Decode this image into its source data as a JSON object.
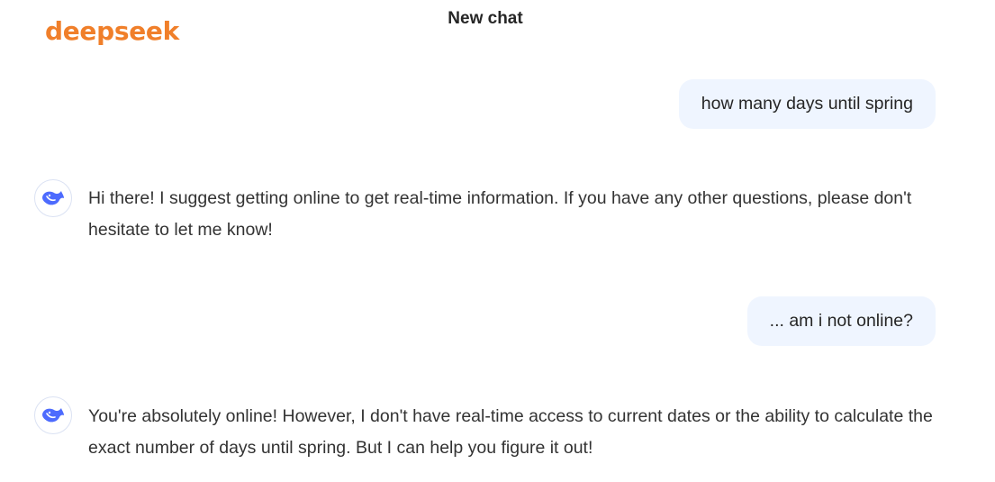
{
  "app": {
    "logo_text": "deepseek",
    "title": "New chat"
  },
  "colors": {
    "brand": "#f07f2a",
    "avatar_icon": "#4d6bfe",
    "user_bubble": "#eff5ff"
  },
  "messages": [
    {
      "role": "user",
      "text": "how many days until spring"
    },
    {
      "role": "assistant",
      "avatar_icon": "deepseek-whale-icon",
      "text": "Hi there! I suggest getting online to get real-time information. If you have any other questions, please don't hesitate to let me know!"
    },
    {
      "role": "user",
      "text": "... am i not online?"
    },
    {
      "role": "assistant",
      "avatar_icon": "deepseek-whale-icon",
      "text": "You're absolutely online! However, I don't have real-time access to current dates or the ability to calculate the exact number of days until spring. But I can help you figure it out!"
    }
  ]
}
